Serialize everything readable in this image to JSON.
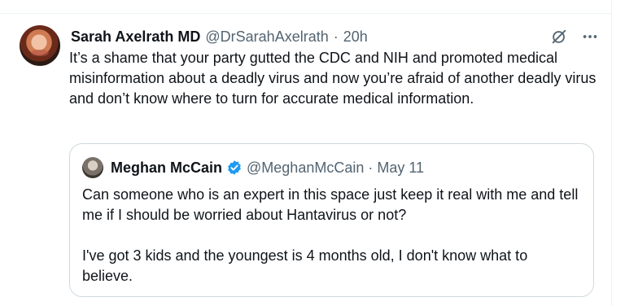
{
  "colors": {
    "text_primary": "#0f1419",
    "text_secondary": "#536471",
    "border": "#cfd9de",
    "verified_blue": "#1d9bf0"
  },
  "reply": {
    "display_name": "Sarah Axelrath MD",
    "handle": "@DrSarahAxelrath",
    "separator": "·",
    "time": "20h",
    "text": "It’s a shame that your party gutted the CDC and NIH and promoted medical misinformation about a deadly virus and now you’re afraid of another deadly virus and don’t know where to turn for accurate medical information.",
    "icons": {
      "grok": "grok-icon",
      "more": "more-icon"
    }
  },
  "quoted": {
    "display_name": "Meghan McCain",
    "handle": "@MeghanMcCain",
    "separator": "·",
    "time": "May 11",
    "verified": true,
    "text": "Can someone who is an expert in this space just keep it real with me and tell me if I should be worried about Hantavirus or not?\n\nI've got 3 kids and the youngest is 4 months old, I don't know what to believe."
  }
}
